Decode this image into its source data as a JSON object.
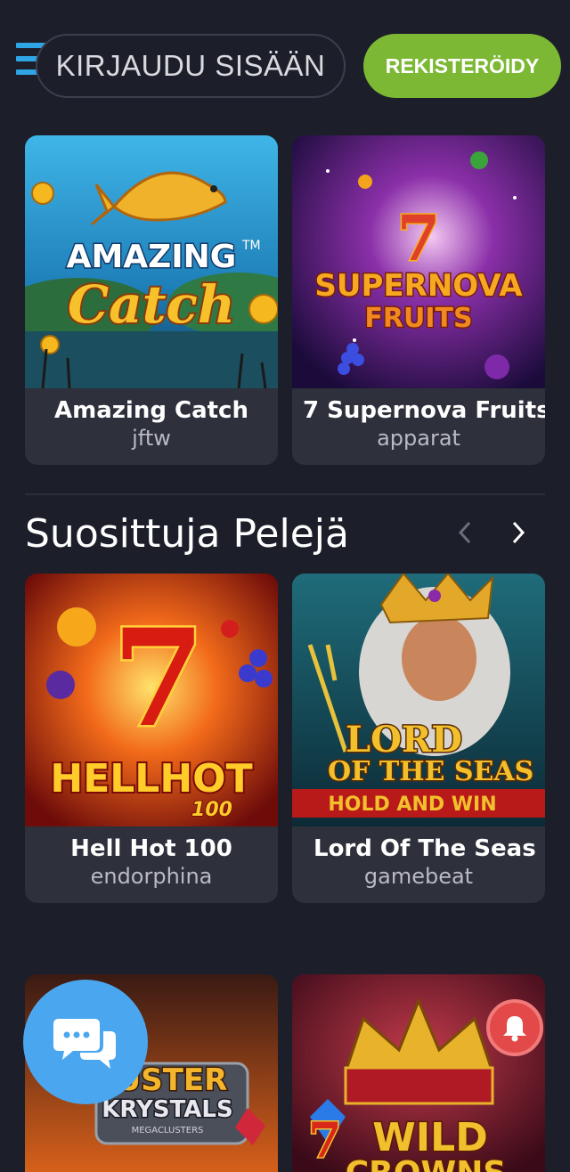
{
  "header": {
    "login_label": "KIRJAUDU SISÄÄN",
    "register_label": "REKISTERÖIDY"
  },
  "top_games": [
    {
      "name": "Amazing Catch",
      "provider": "jftw",
      "art_title": "AMAZING",
      "art_subtitle": "Catch",
      "art_tm": "TM"
    },
    {
      "name": "7 Supernova Fruits",
      "provider": "apparat",
      "art_title": "SUPERNOVA",
      "art_subtitle": "FRUITS",
      "art_number": "7"
    }
  ],
  "popular_section": {
    "title": "Suosittuja Pelejä",
    "prev_icon": "chevron-left-icon",
    "next_icon": "chevron-right-icon",
    "games": [
      {
        "name": "Hell Hot 100",
        "provider": "endorphina",
        "art_title": "HELLHOT",
        "art_subtitle": "100",
        "art_number": "7"
      },
      {
        "name": "Lord Of The Seas",
        "provider": "gamebeat",
        "art_title": "LORD",
        "art_line2": "OF THE SEAS",
        "art_banner": "HOLD AND WIN"
      }
    ]
  },
  "bottom_games": [
    {
      "art_title": "USTER",
      "art_line2": "KRYSTALS",
      "art_line3": "MEGACLUSTERS"
    },
    {
      "art_title": "WILD",
      "art_line2": "CROWNS",
      "art_number": "7"
    }
  ],
  "widgets": {
    "chat_icon": "chat-bubbles-icon",
    "bell_icon": "bell-icon"
  },
  "colors": {
    "background": "#1c1e2a",
    "card": "#2e303b",
    "accent_green": "#7cb834",
    "chat_blue": "#4aa7ef",
    "bell_red": "#e34949",
    "menu_blue": "#2fa5e6"
  }
}
